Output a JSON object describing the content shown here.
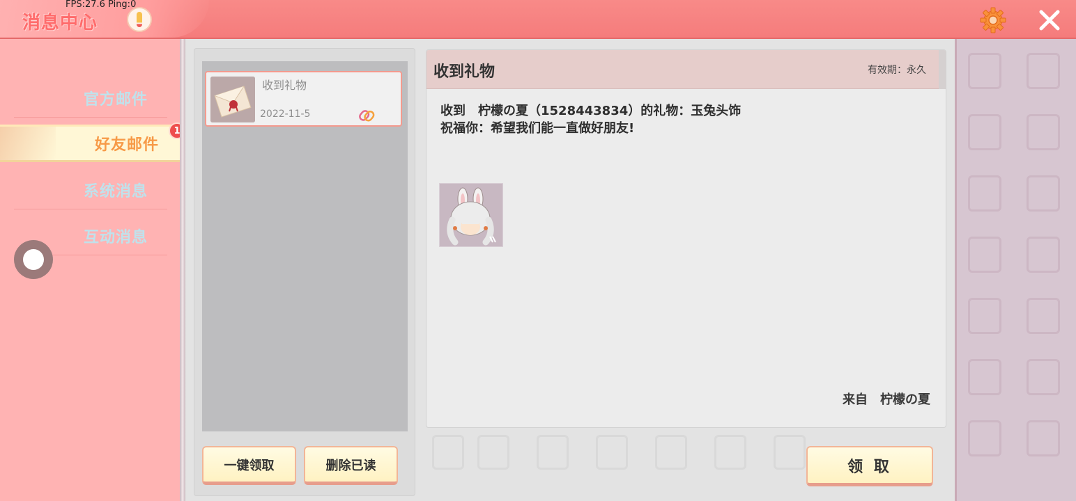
{
  "overlay": {
    "fps_text": "FPS:27.6  Ping:0"
  },
  "header": {
    "title": "消息中心"
  },
  "sidebar": {
    "items": [
      {
        "label": "官方邮件",
        "active": false
      },
      {
        "label": "好友邮件",
        "active": true,
        "badge": "1"
      },
      {
        "label": "系统消息",
        "active": false
      },
      {
        "label": "互动消息",
        "active": false
      }
    ]
  },
  "mail_list": {
    "items": [
      {
        "subject": "收到礼物",
        "date": "2022-11-5",
        "has_attachment": true
      }
    ],
    "buttons": {
      "claim_all": "一键领取",
      "delete_read": "删除已读"
    }
  },
  "detail": {
    "title": "收到礼物",
    "validity": "有效期：永久",
    "body_line1": "收到　柠檬の夏（1528443834）的礼物：玉兔头饰",
    "body_line2": "祝福你：希望我们能一直做好朋友!",
    "item_name": "玉兔头饰",
    "sender": "来自　柠檬の夏",
    "claim_button": "领 取"
  },
  "colors": {
    "topbar": "#f57c7c",
    "sidebar": "#ffb3b3",
    "active_tab": "#fff7d6",
    "active_text": "#f79a47",
    "inactive_text": "#bfe2ec",
    "badge": "#ee4d4d",
    "button": "#fff2c2"
  },
  "icons": [
    "info-icon",
    "gear-icon",
    "close-icon",
    "envelope-icon",
    "attachment-icon"
  ]
}
